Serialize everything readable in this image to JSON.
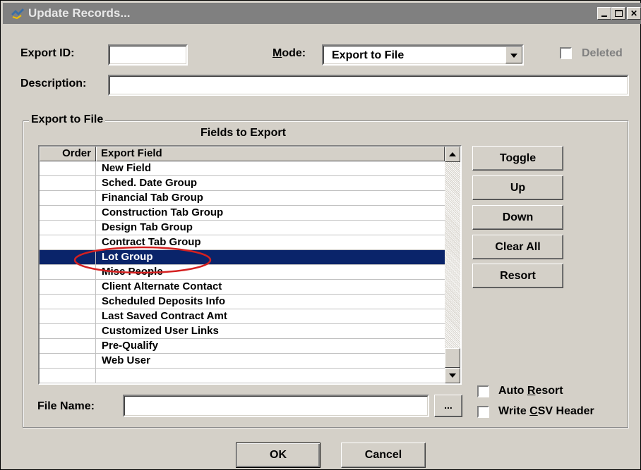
{
  "window": {
    "title": "Update Records..."
  },
  "form": {
    "export_id_label": "Export ID:",
    "export_id_value": "",
    "mode_label_u": "M",
    "mode_label_rest": "ode:",
    "mode_value": "Export to File",
    "deleted_label": "Deleted",
    "description_label": "Description:",
    "description_value": ""
  },
  "group": {
    "title": "Export to File",
    "fields_title": "Fields to Export",
    "columns": {
      "order": "Order",
      "field": "Export Field"
    },
    "rows": [
      {
        "order": "",
        "field": "New Field",
        "selected": false
      },
      {
        "order": "",
        "field": "Sched. Date Group",
        "selected": false
      },
      {
        "order": "",
        "field": "Financial Tab Group",
        "selected": false
      },
      {
        "order": "",
        "field": "Construction Tab Group",
        "selected": false
      },
      {
        "order": "",
        "field": "Design Tab Group",
        "selected": false
      },
      {
        "order": "",
        "field": "Contract Tab Group",
        "selected": false
      },
      {
        "order": "",
        "field": "Lot Group",
        "selected": true
      },
      {
        "order": "",
        "field": "Misc People",
        "selected": false
      },
      {
        "order": "",
        "field": "Client Alternate Contact",
        "selected": false
      },
      {
        "order": "",
        "field": "Scheduled Deposits Info",
        "selected": false
      },
      {
        "order": "",
        "field": "Last Saved Contract Amt",
        "selected": false
      },
      {
        "order": "",
        "field": "Customized User Links",
        "selected": false
      },
      {
        "order": "",
        "field": "Pre-Qualify",
        "selected": false
      },
      {
        "order": "",
        "field": "Web User",
        "selected": false
      },
      {
        "order": "",
        "field": "",
        "selected": false
      }
    ],
    "buttons": {
      "toggle": "Toggle",
      "up": "Up",
      "down": "Down",
      "clear_all": "Clear All",
      "resort": "Resort"
    },
    "file_name_label": "File Name:",
    "file_name_value": "",
    "browse_label": "...",
    "auto_resort_pre": "Auto ",
    "auto_resort_u": "R",
    "auto_resort_post": "esort",
    "write_csv_pre": "Write ",
    "write_csv_u": "C",
    "write_csv_post": "SV Header"
  },
  "footer": {
    "ok": "OK",
    "cancel": "Cancel"
  },
  "colors": {
    "selection": "#0a246a",
    "annotation_circle": "#d42020",
    "titlebar": "#808080"
  }
}
